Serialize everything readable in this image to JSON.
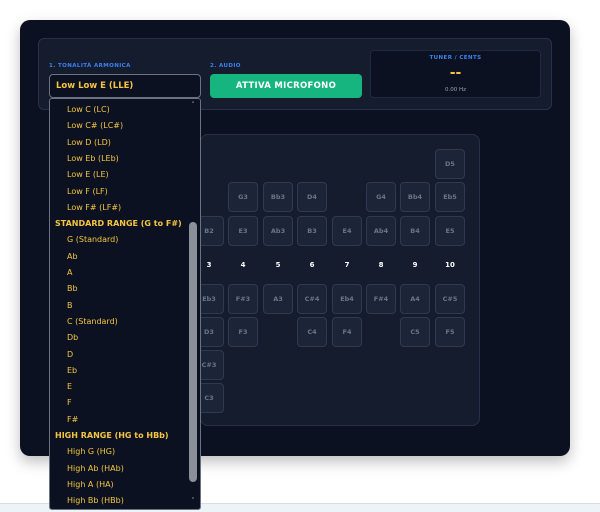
{
  "controls": {
    "tonality_label": "1. TONALITÀ ARMONICA",
    "selected_tonality": "Low Low E (LLE)",
    "audio_label": "2. AUDIO",
    "mic_button": "ATTIVA MICROFONO"
  },
  "tuner": {
    "label": "TUNER / CENTS",
    "value": "--",
    "frequency": "0.00 Hz"
  },
  "dropdown": {
    "scroll_up": "˄",
    "scroll_down": "˅",
    "options": [
      {
        "label": "Low C (LC)",
        "type": "item"
      },
      {
        "label": "Low C# (LC#)",
        "type": "item"
      },
      {
        "label": "Low D (LD)",
        "type": "item"
      },
      {
        "label": "Low Eb (LEb)",
        "type": "item"
      },
      {
        "label": "Low E (LE)",
        "type": "item"
      },
      {
        "label": "Low F (LF)",
        "type": "item"
      },
      {
        "label": "Low F# (LF#)",
        "type": "item"
      },
      {
        "label": "STANDARD RANGE (G to F#)",
        "type": "group"
      },
      {
        "label": "G (Standard)",
        "type": "item"
      },
      {
        "label": "Ab",
        "type": "item"
      },
      {
        "label": "A",
        "type": "item"
      },
      {
        "label": "Bb",
        "type": "item"
      },
      {
        "label": "B",
        "type": "item"
      },
      {
        "label": "C (Standard)",
        "type": "item"
      },
      {
        "label": "Db",
        "type": "item"
      },
      {
        "label": "D",
        "type": "item"
      },
      {
        "label": "Eb",
        "type": "item"
      },
      {
        "label": "E",
        "type": "item"
      },
      {
        "label": "F",
        "type": "item"
      },
      {
        "label": "F#",
        "type": "item"
      },
      {
        "label": "HIGH RANGE (HG to HBb)",
        "type": "group"
      },
      {
        "label": "High G (HG)",
        "type": "item"
      },
      {
        "label": "High Ab (HAb)",
        "type": "item"
      },
      {
        "label": "High A (HA)",
        "type": "item"
      },
      {
        "label": "High Bb (HBb)",
        "type": "item"
      }
    ]
  },
  "board": {
    "hole_numbers": [
      "3",
      "4",
      "5",
      "6",
      "7",
      "8",
      "9",
      "10"
    ],
    "keys": {
      "top1": [
        "D5"
      ],
      "top2": [
        "G3",
        "Bb3",
        "D4",
        "G4",
        "Bb4",
        "Eb5"
      ],
      "blow": [
        "B2",
        "E3",
        "Ab3",
        "B3",
        "E4",
        "Ab4",
        "B4",
        "E5"
      ],
      "draw": [
        "Eb3",
        "F#3",
        "A3",
        "C#4",
        "Eb4",
        "F#4",
        "A4",
        "C#5"
      ],
      "bend1": [
        "D3",
        "F3",
        "C4",
        "F4",
        "C5",
        "F5"
      ],
      "bend2": [
        "C#3"
      ],
      "bend3": [
        "C3"
      ]
    }
  }
}
